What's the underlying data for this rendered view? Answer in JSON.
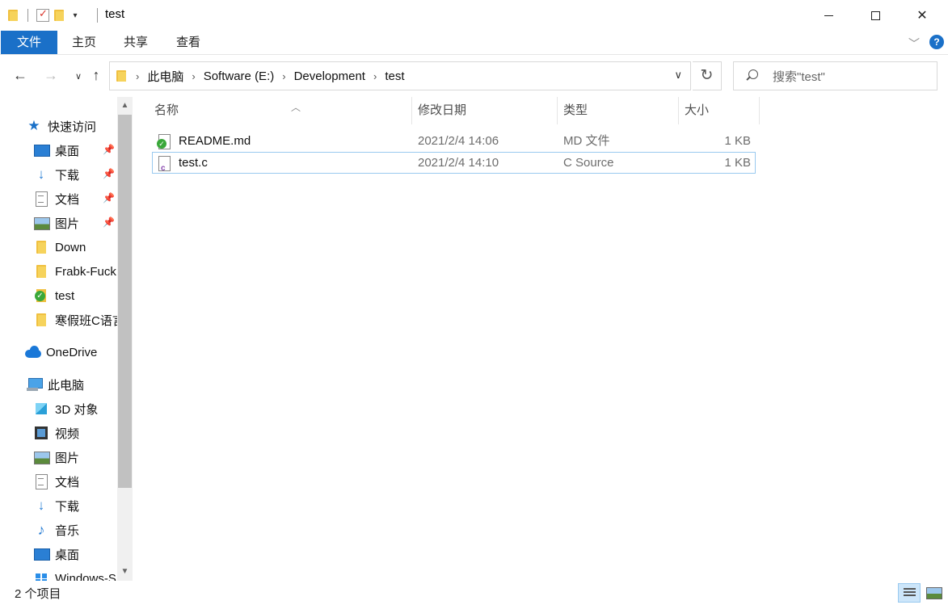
{
  "window": {
    "title": "test"
  },
  "ribbon": {
    "tabs": [
      "文件",
      "主页",
      "共享",
      "查看"
    ]
  },
  "address": {
    "crumbs": [
      "此电脑",
      "Software (E:)",
      "Development",
      "test"
    ]
  },
  "search": {
    "placeholder": "搜索\"test\""
  },
  "sidebar": {
    "quick_access": "快速访问",
    "pinned": [
      "桌面",
      "下载",
      "文档",
      "图片"
    ],
    "folders": [
      "Down",
      "Frabk-Fuck",
      "test",
      "寒假班C语言"
    ],
    "onedrive": "OneDrive",
    "this_pc": "此电脑",
    "pc_items": [
      "3D 对象",
      "视频",
      "图片",
      "文档",
      "下载",
      "音乐",
      "桌面",
      "Windows-S"
    ]
  },
  "columns": {
    "name": "名称",
    "modified": "修改日期",
    "type": "类型",
    "size": "大小"
  },
  "files": [
    {
      "name": "README.md",
      "modified": "2021/2/4 14:06",
      "type": "MD 文件",
      "size": "1 KB",
      "icon": "markdown-file-icon"
    },
    {
      "name": "test.c",
      "modified": "2021/2/4 14:10",
      "type": "C Source",
      "size": "1 KB",
      "icon": "c-source-file-icon"
    }
  ],
  "status": {
    "count": "2 个项目"
  },
  "colors": {
    "accent": "#1a70c8",
    "selection_border": "#99c9ef"
  }
}
